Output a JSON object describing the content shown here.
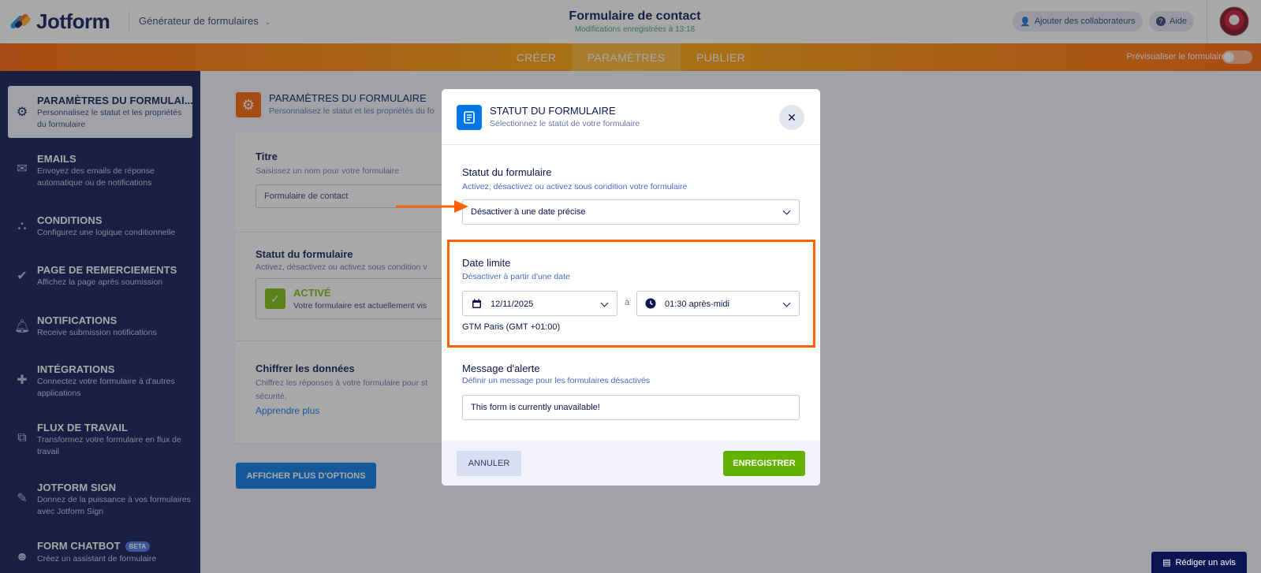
{
  "header": {
    "brand": "Jotform",
    "builder_label": "Générateur de formulaires",
    "form_title": "Formulaire de contact",
    "saved_status": "Modifications enregistrées à 13:18",
    "collaborators": "Ajouter des collaborateurs",
    "help": "Aide"
  },
  "nav": {
    "tabs": [
      "CRÉER",
      "PARAMÈTRES",
      "PUBLIER"
    ],
    "active_tab": "PARAMÈTRES",
    "preview": "Prévisualiser le formulaire"
  },
  "sidebar": {
    "items": [
      {
        "title": "PARAMÈTRES DU FORMULAI...",
        "desc": "Personnalisez le statut et les propriétés du formulaire",
        "icon": "gear-icon"
      },
      {
        "title": "EMAILS",
        "desc": "Envoyez des emails de réponse automatique ou de notifications",
        "icon": "envelope-icon"
      },
      {
        "title": "CONDITIONS",
        "desc": "Configurez une logique conditionnelle",
        "icon": "flow-icon"
      },
      {
        "title": "PAGE DE REMERCIEMENTS",
        "desc": "Affichez la page après soumission",
        "icon": "check-circle-icon"
      },
      {
        "title": "NOTIFICATIONS",
        "desc": "Receive submission notifications",
        "icon": "bell-icon"
      },
      {
        "title": "INTÉGRATIONS",
        "desc": "Connectez votre formulaire à d'autres applications",
        "icon": "puzzle-icon"
      },
      {
        "title": "FLUX DE TRAVAIL",
        "desc": "Transformez votre formulaire en flux de travail",
        "icon": "workflow-icon"
      },
      {
        "title": "JOTFORM SIGN",
        "desc": "Donnez de la puissance à vos formulaires avec Jotform Sign",
        "icon": "pen-icon"
      },
      {
        "title": "FORM CHATBOT",
        "desc": "Créez un assistant de formulaire",
        "icon": "chatbot-icon",
        "badge": "BETA"
      }
    ]
  },
  "main": {
    "heading": "PARAMÈTRES DU FORMULAIRE",
    "heading_desc": "Personnalisez le statut et les propriétés du fo",
    "title_label": "Titre",
    "title_desc": "Saisissez un nom pour votre formulaire",
    "title_value": "Formulaire de contact",
    "status_label": "Statut du formulaire",
    "status_desc": "Activez, désactivez ou activez sous condition v",
    "status_name": "ACTIVÉ",
    "status_text": "Votre formulaire est actuellement vis",
    "encrypt_label": "Chiffrer les données",
    "encrypt_desc": "Chiffrez les réponses à votre formulaire pour st sécurité.",
    "learn_more": "Apprendre plus",
    "more_options": "AFFICHER PLUS D'OPTIONS"
  },
  "modal": {
    "title": "STATUT DU FORMULAIRE",
    "subtitle": "Sélectionnez le statut de votre formulaire",
    "status_label": "Statut du formulaire",
    "status_desc": "Activez, désactivez ou activez sous condition votre formulaire",
    "status_value": "Désactiver à une date précise",
    "deadline_label": "Date limite",
    "deadline_desc": "Désactiver à partir d'une date",
    "date_value": "12/11/2025",
    "at": "à",
    "time_value": "01:30 après-midi",
    "timezone": "GTM Paris (GMT +01:00)",
    "alert_label": "Message d'alerte",
    "alert_desc": "Définir un message pour les formulaires désactivés",
    "alert_value": "This form is currently unavailable!",
    "cancel": "ANNULER",
    "save": "ENREGISTRER"
  },
  "review": "Rédiger un avis",
  "colors": {
    "brand_navy": "#0a1551",
    "orange": "#ff6100",
    "save_green": "#64b200",
    "blue": "#0075e3",
    "active_green": "#78bb07"
  }
}
